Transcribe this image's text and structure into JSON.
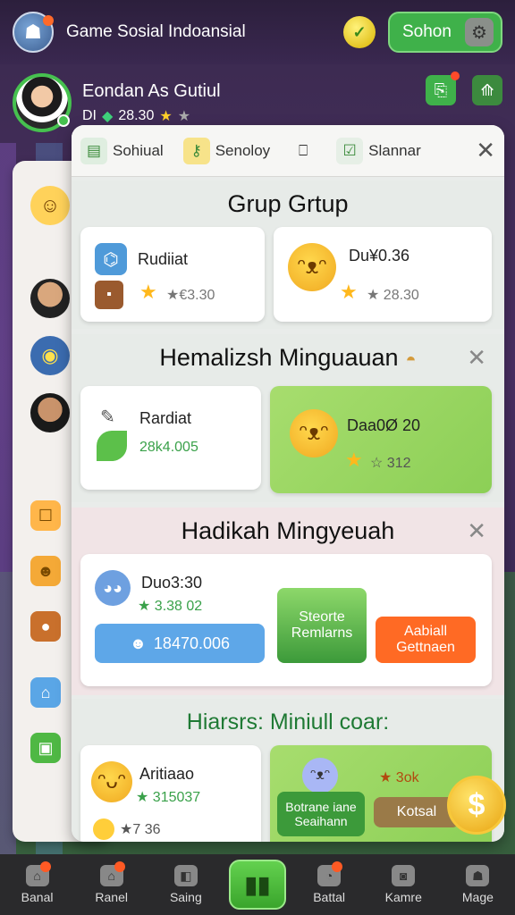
{
  "app": {
    "title": "Game Sosial Indoansial"
  },
  "topbar": {
    "action_label": "Sohon"
  },
  "profile": {
    "name": "Eondan As Gutiul",
    "stats": "DI",
    "score": "28.30"
  },
  "tabs": [
    {
      "label": "Sohiual"
    },
    {
      "label": "Senoloy"
    },
    {
      "label": ""
    },
    {
      "label": "Slannar"
    }
  ],
  "sections": {
    "grup": {
      "title": "Grup Grtup",
      "cards": [
        {
          "name": "Rudiiat",
          "value": "★€3.30"
        },
        {
          "name": "Du¥0.36",
          "value": "★ 28.30"
        }
      ]
    },
    "hemalizsh": {
      "title": "Hemalizsh Minguauan",
      "cards": [
        {
          "name": "Rardiat",
          "value": "28k4.005"
        },
        {
          "name": "Daa0Ø 20",
          "value": "☆ 312"
        }
      ]
    },
    "hadikah": {
      "title": "Hadikah Mingyeuah",
      "card": {
        "name": "Duo3:30",
        "value": "★ 3.38 02",
        "button": "18470.006"
      },
      "btn_green": "Steorte Remlarns",
      "btn_orange": "Aabiall Gettnaen"
    },
    "hiarsrs": {
      "title": "Hiarsrs: Miniull coar:",
      "card": {
        "name": "Aritiaao",
        "value": "★ 315037",
        "coins": "★7 36"
      },
      "btn_green": "Botrane iane Seaihann",
      "stat": "★ 3ok",
      "btn_brown": "Kotsal"
    }
  },
  "bottom_nav": [
    {
      "label": "Banal"
    },
    {
      "label": "Ranel"
    },
    {
      "label": "Saing"
    },
    {
      "label": ""
    },
    {
      "label": "Battal"
    },
    {
      "label": "Kamre"
    },
    {
      "label": "Mage"
    }
  ],
  "colors": {
    "accent_green": "#3fb14a",
    "highlight_green": "#9bd764",
    "orange": "#ff6a24"
  }
}
